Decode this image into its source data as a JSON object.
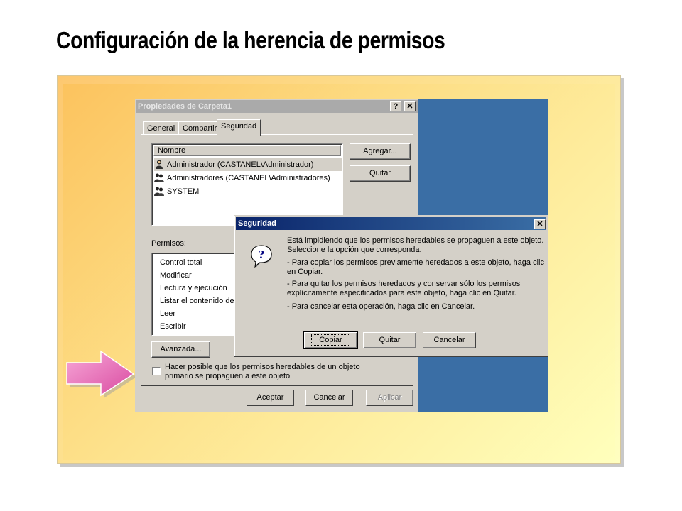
{
  "slide": {
    "title": "Configuración de la herencia de permisos"
  },
  "props_window": {
    "title": "Propiedades de Carpeta1",
    "help_button": "?",
    "close_button": "✕",
    "tabs": [
      {
        "label": "General"
      },
      {
        "label": "Compartir"
      },
      {
        "label": "Seguridad"
      }
    ],
    "names_header": "Nombre",
    "users": [
      {
        "label": "Administrador (CASTANEL\\Administrador)",
        "icon": "user-icon"
      },
      {
        "label": "Administradores (CASTANEL\\Administradores)",
        "icon": "group-icon"
      },
      {
        "label": "SYSTEM",
        "icon": "group-icon"
      }
    ],
    "add_button": "Agregar...",
    "remove_button": "Quitar",
    "permissions_label": "Permisos:",
    "permissions": [
      {
        "label": "Control total"
      },
      {
        "label": "Modificar"
      },
      {
        "label": "Lectura y ejecución"
      },
      {
        "label": "Listar el contenido de"
      },
      {
        "label": "Leer"
      },
      {
        "label": "Escribir"
      }
    ],
    "advanced_button": "Avanzada...",
    "inherit_checkbox_line1": "Hacer posible que los permisos heredables de un objeto",
    "inherit_checkbox_line2": "primario se propaguen a este objeto",
    "inherit_checked": false,
    "ok_button": "Aceptar",
    "cancel_button": "Cancelar",
    "apply_button": "Aplicar"
  },
  "security_dialog": {
    "title": "Seguridad",
    "close_button": "✕",
    "icon": "question-icon",
    "lines": [
      "Está impidiendo que los permisos heredables se propaguen a este objeto.",
      "Seleccione la opción que corresponda.",
      "- Para copiar los permisos previamente heredados a este objeto, haga clic",
      "en Copiar.",
      "- Para quitar los permisos heredados y conservar sólo los permisos",
      "explícitamente especificados para este objeto, haga clic en Quitar.",
      "- Para cancelar esta operación, haga clic en Cancelar."
    ],
    "copy_button": "Copiar",
    "remove_button": "Quitar",
    "cancel_button": "Cancelar"
  },
  "colors": {
    "desktop": "#3a6ea5",
    "active_title": "#0a246a",
    "inactive_title": "#aaaaaa",
    "arrow": "#e86ab0"
  }
}
